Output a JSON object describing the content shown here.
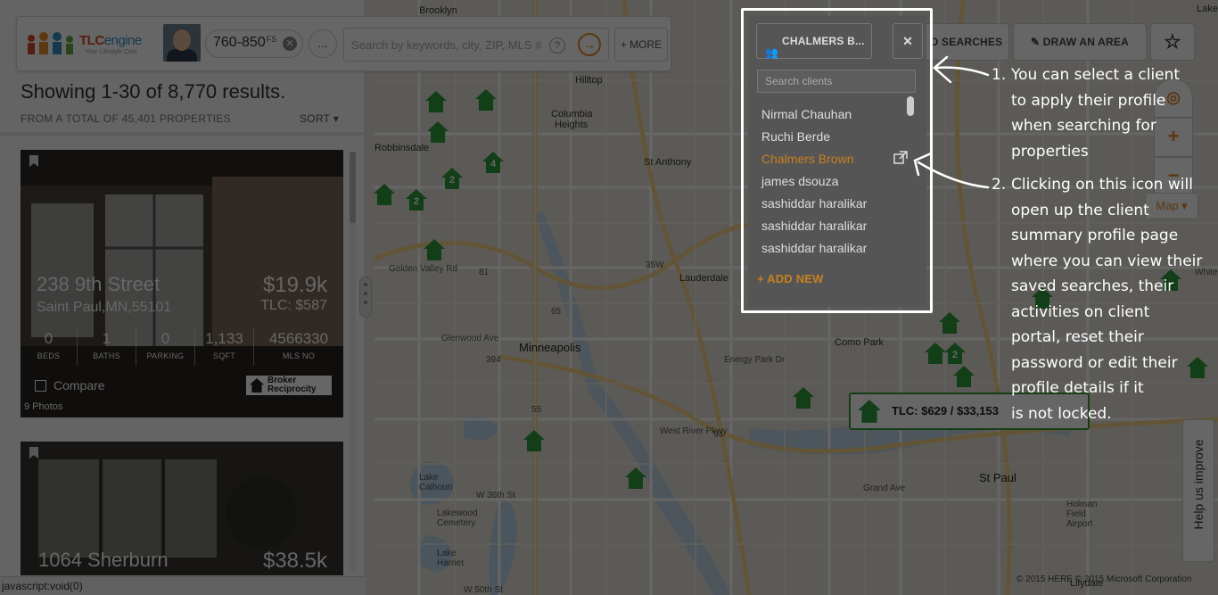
{
  "header": {
    "brand_prefix": "TLC",
    "brand_suffix": "engine",
    "tagline": "Your Lifestyle Cost",
    "price_range": "760-850",
    "price_suffix": "FS",
    "more_dots": "...",
    "search_placeholder": "Search by keywords, city, ZIP, MLS #",
    "help_glyph": "?",
    "go_glyph": "→",
    "more_label": "+ MORE"
  },
  "results": {
    "title": "Showing 1-30 of 8,770 results.",
    "subtitle": "FROM A TOTAL OF 45,401 PROPERTIES",
    "sort_label": "SORT ▾"
  },
  "listings": [
    {
      "address": "238 9th Street",
      "city": "Saint Paul,MN,55101",
      "price": "$19.9k",
      "tlc": "TLC: $587",
      "stats": [
        {
          "value": "0",
          "label": "BEDS"
        },
        {
          "value": "1",
          "label": "BATHS"
        },
        {
          "value": "0",
          "label": "PARKING"
        },
        {
          "value": "1,133",
          "label": "SQFT"
        },
        {
          "value": "4566330",
          "label": "MLS NO"
        }
      ],
      "compare_label": "Compare",
      "broker_line1": "Broker",
      "broker_line2": "Reciprocity",
      "photos": "9 Photos"
    },
    {
      "address": "1064 Sherburn",
      "price": "$38.5k"
    }
  ],
  "map_toolbar": {
    "client_button": "CHALMERS B...",
    "close_glyph": "✕",
    "saved_searches": "D SEARCHES",
    "draw_area": "DRAW AN AREA",
    "zoom_in": "+",
    "zoom_out": "−",
    "map_type": "Map ▾",
    "popup_text": "TLC: $629 / $33,153",
    "help_improve": "Help us improve",
    "copyright": "© 2015 HERE   © 2015 Microsoft Corporation"
  },
  "client_panel": {
    "button_label": "CHALMERS B...",
    "search_placeholder": "Search clients",
    "clients": [
      "Nirmal Chauhan",
      "Ruchi Berde",
      "Chalmers Brown",
      "james dsouza",
      "sashiddar haralikar",
      "sashiddar haralikar",
      "sashiddar haralikar"
    ],
    "add_new": "+ ADD NEW"
  },
  "annotations": {
    "a1": {
      "num": "1.",
      "lines": [
        "You can select a client",
        "to apply their profile",
        "when searching for",
        "properties"
      ]
    },
    "a2": {
      "num": "2.",
      "lines": [
        "Clicking on this icon will",
        "open up the client",
        "summary profile page",
        "where you can view their",
        "saved searches, their",
        "activities on client",
        "portal, reset their",
        "password or edit their",
        "profile details if it",
        "is not locked."
      ]
    }
  },
  "map_labels": {
    "brooklyn": "Brooklyn",
    "hilltop": "Hilltop",
    "columbia": "Columbia",
    "heights": "Heights",
    "stanthony": "St Anthony",
    "robbinsdale": "Robbinsdale",
    "lauderdale": "Lauderdale",
    "minneapolis": "Minneapolis",
    "comopark": "Como Park",
    "stpaul": "St Paul",
    "lakecalhoun": "Lake\nCalhoun",
    "lakewood": "Lakewood\nCemetery",
    "lakeharriet": "Lake\nHarriet",
    "holman": "Holman\nField\nAirport",
    "lilydale": "Lilydale",
    "goldenvalley": "Golden Valley Rd",
    "glenwood": "Glenwood Ave",
    "energypark": "Energy Park Dr",
    "grandave": "Grand Ave",
    "w36th": "W 36th St",
    "w50th": "W 50th St",
    "westriver": "West River Pkwy",
    "whitebear": "White Bear Ave",
    "lakeshore": "Lake Sho",
    "hwy65": "65",
    "hwy81": "81",
    "hwy55": "55",
    "hwy94": "94",
    "hwy35w": "35W",
    "hwy394": "394"
  },
  "map_pins": [
    "4",
    "2",
    "2",
    "2"
  ],
  "status_bar": "javascript:void(0)",
  "colors": {
    "accent": "#e58b2a",
    "pin": "#2e9c3e",
    "brand_red": "#d64a26"
  }
}
